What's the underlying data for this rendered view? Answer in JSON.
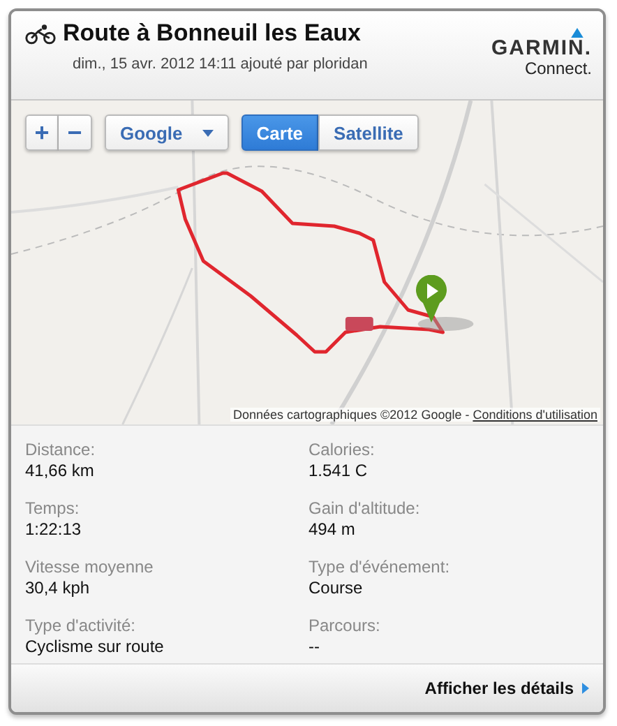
{
  "header": {
    "title": "Route à Bonneuil les Eaux",
    "subtitle": "dim., 15 avr. 2012 14:11 ajouté par ploridan",
    "logo": {
      "brand": "GARMIN.",
      "product": "Connect."
    }
  },
  "map": {
    "kind": "picture",
    "zoom_buttons": [
      "+",
      "−"
    ],
    "provider": "Google",
    "map_types": [
      {
        "label": "Carte",
        "selected": true
      },
      {
        "label": "Satellite",
        "selected": false
      }
    ],
    "attribution": "Données cartographiques ©2012 Google - ",
    "terms_link": "Conditions d'utilisation"
  },
  "stats": [
    {
      "label": "Distance:",
      "value": "41,66 km"
    },
    {
      "label": "Calories:",
      "value": "1.541 C"
    },
    {
      "label": "Temps:",
      "value": "1:22:13"
    },
    {
      "label": "Gain d'altitude:",
      "value": "494 m"
    },
    {
      "label": "Vitesse moyenne",
      "value": "30,4 kph"
    },
    {
      "label": "Type d'événement:",
      "value": "Course"
    },
    {
      "label": "Type d'activité:",
      "value": "Cyclisme sur route"
    },
    {
      "label": "Parcours:",
      "value": "--"
    }
  ],
  "footer": {
    "link": "Afficher les détails"
  }
}
